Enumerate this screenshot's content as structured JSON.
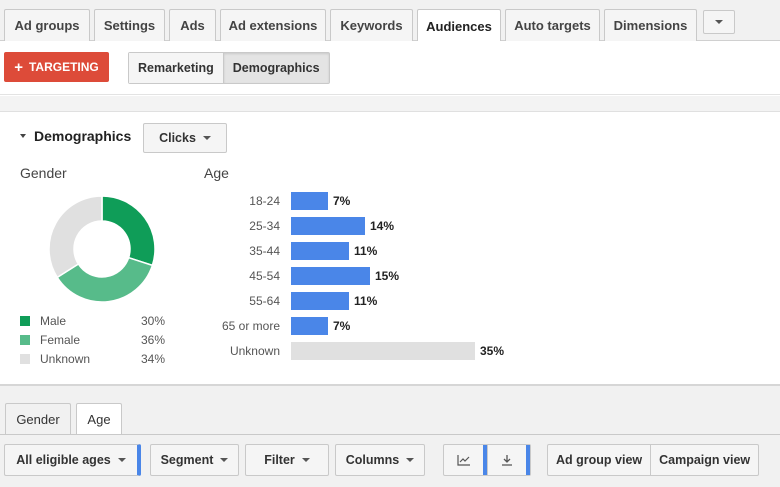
{
  "tabs": [
    {
      "label": "Ad groups",
      "active": false
    },
    {
      "label": "Settings",
      "active": false
    },
    {
      "label": "Ads",
      "active": false
    },
    {
      "label": "Ad extensions",
      "active": false
    },
    {
      "label": "Keywords",
      "active": false
    },
    {
      "label": "Audiences",
      "active": true
    },
    {
      "label": "Auto targets",
      "active": false
    },
    {
      "label": "Dimensions",
      "active": false
    }
  ],
  "toolbar": {
    "targeting_label": "TARGETING",
    "segments": [
      {
        "label": "Remarketing",
        "active": false
      },
      {
        "label": "Demographics",
        "active": true
      }
    ]
  },
  "panel": {
    "title": "Demographics",
    "metric_dropdown": "Clicks",
    "gender_heading": "Gender",
    "age_heading": "Age"
  },
  "gender": [
    {
      "label": "Male",
      "value": "30%",
      "color": "#0f9d58"
    },
    {
      "label": "Female",
      "value": "36%",
      "color": "#57bb8a"
    },
    {
      "label": "Unknown",
      "value": "34%",
      "color": "#e0e0e0"
    }
  ],
  "age": [
    {
      "label": "18-24",
      "value": "7%",
      "color": "#4a86e8"
    },
    {
      "label": "25-34",
      "value": "14%",
      "color": "#4a86e8"
    },
    {
      "label": "35-44",
      "value": "11%",
      "color": "#4a86e8"
    },
    {
      "label": "45-54",
      "value": "15%",
      "color": "#4a86e8"
    },
    {
      "label": "55-64",
      "value": "11%",
      "color": "#4a86e8"
    },
    {
      "label": "65 or more",
      "value": "7%",
      "color": "#4a86e8"
    },
    {
      "label": "Unknown",
      "value": "35%",
      "color": "#e0e0e0"
    }
  ],
  "bottom_tabs": [
    {
      "label": "Gender",
      "active": false
    },
    {
      "label": "Age",
      "active": true
    }
  ],
  "bottom_toolbar": {
    "eligible": "All eligible ages",
    "segment": "Segment",
    "filter": "Filter",
    "columns": "Columns",
    "adgroup_view": "Ad group view",
    "campaign_view": "Campaign view"
  }
}
